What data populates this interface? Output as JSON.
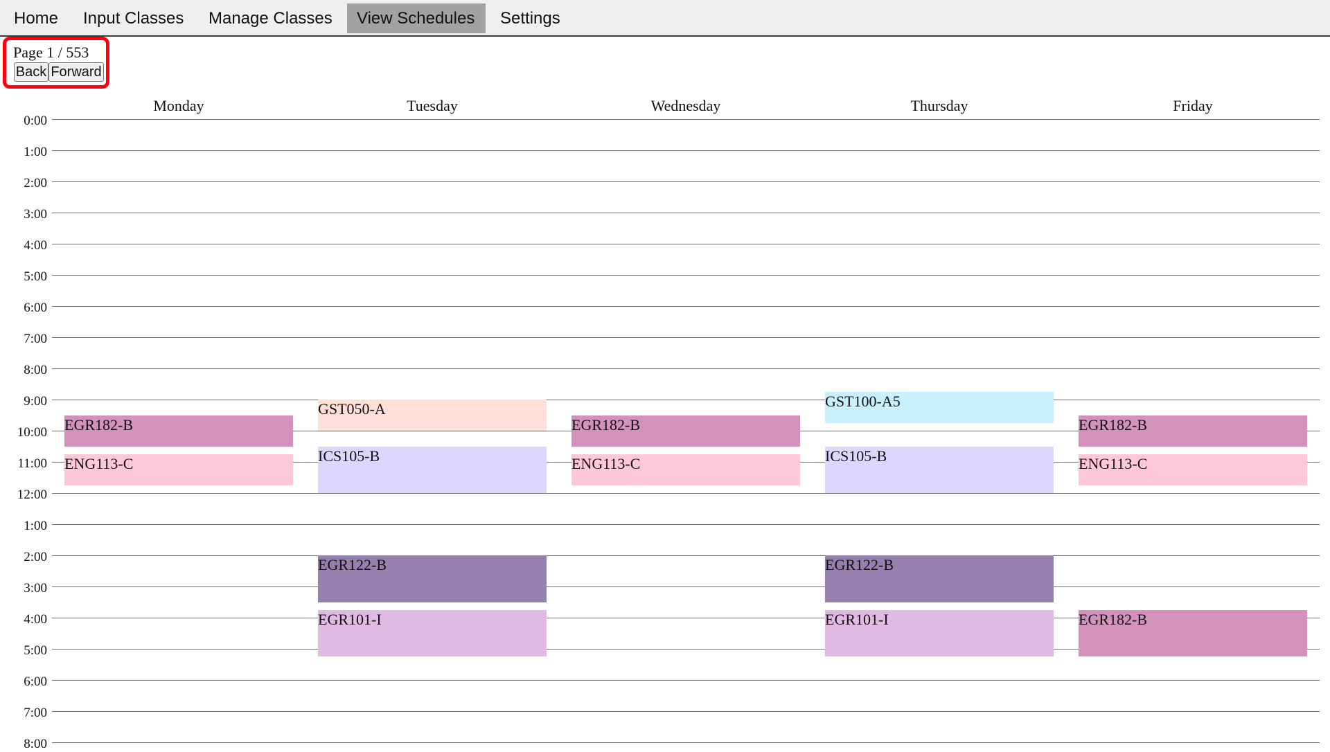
{
  "nav": {
    "items": [
      {
        "label": "Home",
        "active": false
      },
      {
        "label": "Input Classes",
        "active": false
      },
      {
        "label": "Manage Classes",
        "active": false
      },
      {
        "label": "View Schedules",
        "active": true
      },
      {
        "label": "Settings",
        "active": false
      }
    ]
  },
  "pager": {
    "page_text": "Page 1 / 553",
    "back_label": "Back",
    "forward_label": "Forward"
  },
  "schedule": {
    "days": [
      "Monday",
      "Tuesday",
      "Wednesday",
      "Thursday",
      "Friday"
    ],
    "hours": [
      "0:00",
      "1:00",
      "2:00",
      "3:00",
      "4:00",
      "5:00",
      "6:00",
      "7:00",
      "8:00",
      "9:00",
      "10:00",
      "11:00",
      "12:00",
      "1:00",
      "2:00",
      "3:00",
      "4:00",
      "5:00",
      "6:00",
      "7:00",
      "8:00"
    ],
    "classes": [
      {
        "day": "Monday",
        "name": "EGR182-B",
        "start": 9.5,
        "end": 10.5,
        "color": "#d292bb"
      },
      {
        "day": "Monday",
        "name": "ENG113-C",
        "start": 10.75,
        "end": 11.75,
        "color": "#ffc8d8"
      },
      {
        "day": "Tuesday",
        "name": "GST050-A",
        "start": 9.0,
        "end": 10.0,
        "color": "#ffdfd6"
      },
      {
        "day": "Tuesday",
        "name": "ICS105-B",
        "start": 10.5,
        "end": 12.0,
        "color": "#dcd6fc"
      },
      {
        "day": "Tuesday",
        "name": "EGR122-B",
        "start": 14.0,
        "end": 15.5,
        "color": "#977fae"
      },
      {
        "day": "Tuesday",
        "name": "EGR101-I",
        "start": 15.75,
        "end": 17.25,
        "color": "#e0bae3"
      },
      {
        "day": "Wednesday",
        "name": "EGR182-B",
        "start": 9.5,
        "end": 10.5,
        "color": "#d292bb"
      },
      {
        "day": "Wednesday",
        "name": "ENG113-C",
        "start": 10.75,
        "end": 11.75,
        "color": "#ffc8d8"
      },
      {
        "day": "Thursday",
        "name": "GST100-A5",
        "start": 8.75,
        "end": 9.75,
        "color": "#caeffc"
      },
      {
        "day": "Thursday",
        "name": "ICS105-B",
        "start": 10.5,
        "end": 12.0,
        "color": "#dcd6fc"
      },
      {
        "day": "Thursday",
        "name": "EGR122-B",
        "start": 14.0,
        "end": 15.5,
        "color": "#977fae"
      },
      {
        "day": "Thursday",
        "name": "EGR101-I",
        "start": 15.75,
        "end": 17.25,
        "color": "#e0bae3"
      },
      {
        "day": "Friday",
        "name": "EGR182-B",
        "start": 9.5,
        "end": 10.5,
        "color": "#d292bb"
      },
      {
        "day": "Friday",
        "name": "ENG113-C",
        "start": 10.75,
        "end": 11.75,
        "color": "#ffc8d8"
      },
      {
        "day": "Friday",
        "name": "EGR182-B",
        "start": 15.75,
        "end": 17.25,
        "color": "#d292bb"
      }
    ]
  }
}
